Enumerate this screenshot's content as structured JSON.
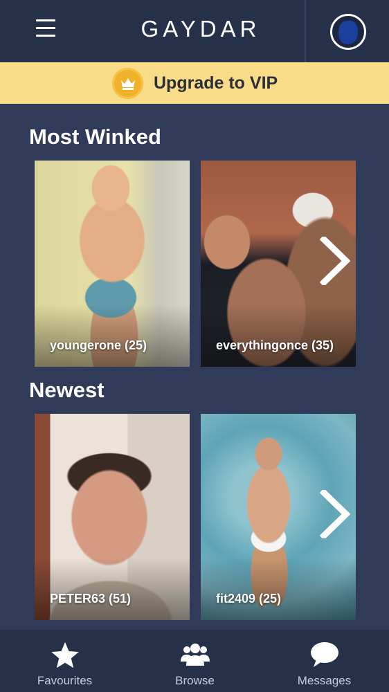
{
  "header": {
    "logo_text": "GAYDAR",
    "menu_icon": "hamburger-menu-icon",
    "avatar_icon": "profile-avatar-icon"
  },
  "vip_banner": {
    "label": "Upgrade to VIP",
    "icon": "crown-icon",
    "background_color": "#f8dc87",
    "icon_color": "#f2b12b"
  },
  "sections": [
    {
      "title": "Most Winked",
      "cards": [
        {
          "label": "youngerone (25)"
        },
        {
          "label": "everythingonce (35)"
        }
      ],
      "next_icon": "chevron-right-icon"
    },
    {
      "title": "Newest",
      "cards": [
        {
          "label": "PETER63 (51)"
        },
        {
          "label": "fit2409 (25)"
        }
      ],
      "next_icon": "chevron-right-icon"
    }
  ],
  "bottom_nav": {
    "items": [
      {
        "label": "Favourites",
        "icon": "star-icon"
      },
      {
        "label": "Browse",
        "icon": "people-group-icon"
      },
      {
        "label": "Messages",
        "icon": "speech-bubble-icon"
      }
    ]
  },
  "colors": {
    "page_background": "#2f3b58",
    "header_background": "#253049",
    "text": "#ffffff"
  }
}
